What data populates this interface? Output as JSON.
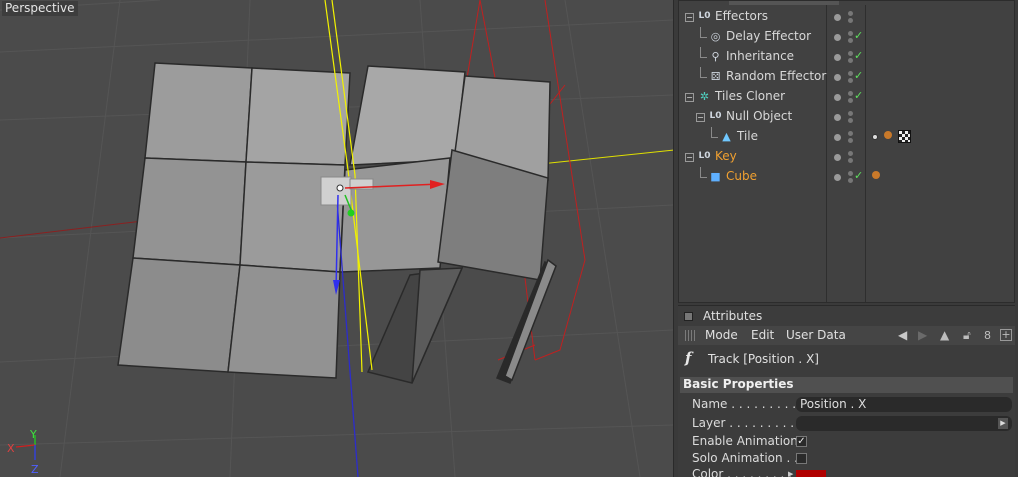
{
  "viewport": {
    "label": "Perspective",
    "axis": {
      "x": "X",
      "y": "Y",
      "z": "Z"
    }
  },
  "object_manager": {
    "rows": [
      {
        "name": "Effectors",
        "icon": "null-object-icon",
        "level": 0,
        "color": "normal",
        "check": false,
        "tags": []
      },
      {
        "name": "Delay Effector",
        "icon": "delay-effector-icon",
        "level": 1,
        "color": "normal",
        "check": true,
        "tags": []
      },
      {
        "name": "Inheritance",
        "icon": "inheritance-effector-icon",
        "level": 1,
        "color": "normal",
        "check": true,
        "tags": []
      },
      {
        "name": "Random Effector",
        "icon": "random-effector-icon",
        "level": 1,
        "color": "normal",
        "check": true,
        "tags": []
      },
      {
        "name": "Tiles Cloner",
        "icon": "cloner-icon",
        "level": 0,
        "color": "normal",
        "check": true,
        "tags": []
      },
      {
        "name": "Null Object",
        "icon": "null-object-icon",
        "level": 1,
        "color": "normal",
        "check": false,
        "tags": []
      },
      {
        "name": "Tile",
        "icon": "tile-icon",
        "level": 2,
        "color": "normal",
        "check": false,
        "tags": [
          "phong-tag",
          "material-tag",
          "checker-material-tag"
        ]
      },
      {
        "name": "Key",
        "icon": "null-object-icon",
        "level": 0,
        "color": "orange",
        "check": false,
        "tags": []
      },
      {
        "name": "Cube",
        "icon": "cube-icon",
        "level": 1,
        "color": "orange",
        "check": true,
        "tags": [
          "material-tag"
        ]
      }
    ]
  },
  "attributes": {
    "title": "Attributes",
    "menu": {
      "mode": "Mode",
      "edit": "Edit",
      "user_data": "User Data"
    },
    "track_label": "Track [Position . X]",
    "section": "Basic Properties",
    "props": {
      "name_label": "Name . . . . . . . . . . .",
      "name_value": "Position . X",
      "layer_label": "Layer . . . . . . . . . . .",
      "enable_label": "Enable Animation",
      "enable_checked": true,
      "solo_label": "Solo Animation . .",
      "solo_checked": false,
      "color_label": "Color . . . . . . . . . .",
      "color_value": "#b00000"
    }
  }
}
